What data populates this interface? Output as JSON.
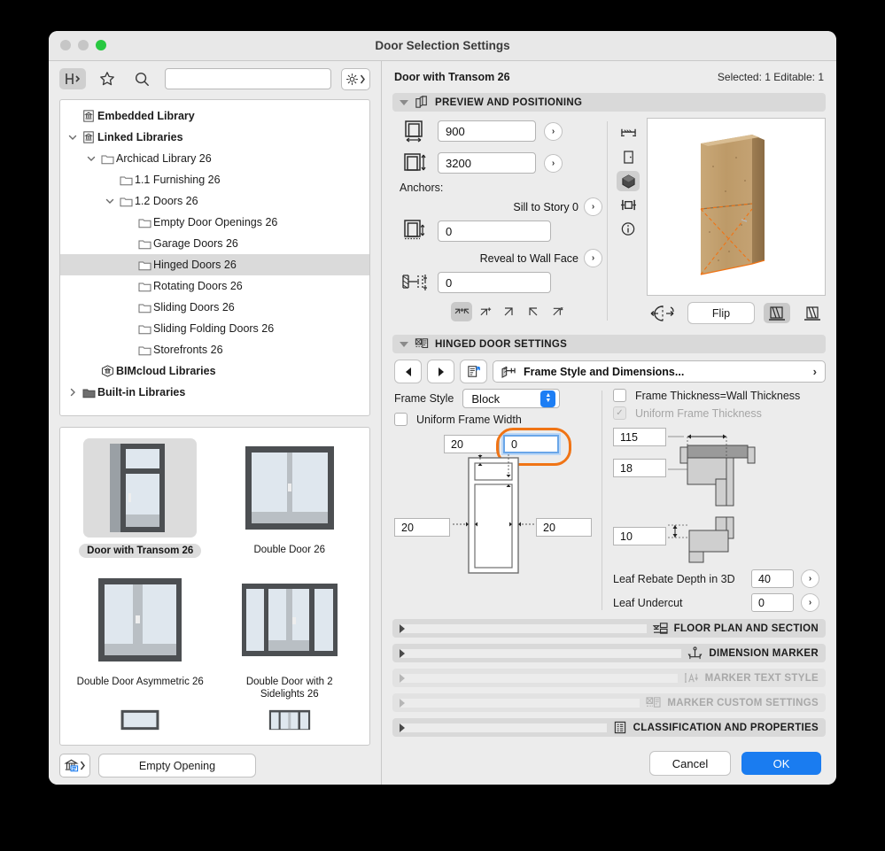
{
  "window": {
    "title": "Door Selection Settings"
  },
  "left_panel": {
    "toolbar": {
      "object_tool_icon": "chair-icon",
      "favorites_icon": "star-icon",
      "search_icon": "magnifier-icon",
      "search_value": "",
      "search_placeholder": "",
      "settings_icon": "gear-icon"
    },
    "tree": [
      {
        "label": "Embedded Library",
        "depth": 0,
        "bold": true,
        "icon": "embedded-library-icon",
        "twisty": "none",
        "selected": false
      },
      {
        "label": "Linked Libraries",
        "depth": 0,
        "bold": true,
        "icon": "linked-library-icon",
        "twisty": "open",
        "selected": false
      },
      {
        "label": "Archicad Library 26",
        "depth": 1,
        "bold": false,
        "icon": "folder-icon",
        "twisty": "open",
        "selected": false
      },
      {
        "label": "1.1 Furnishing 26",
        "depth": 2,
        "bold": false,
        "icon": "folder-icon",
        "twisty": "none",
        "selected": false
      },
      {
        "label": "1.2 Doors 26",
        "depth": 2,
        "bold": false,
        "icon": "folder-icon",
        "twisty": "open",
        "selected": false
      },
      {
        "label": "Empty Door Openings 26",
        "depth": 3,
        "bold": false,
        "icon": "folder-icon",
        "twisty": "none",
        "selected": false
      },
      {
        "label": "Garage Doors 26",
        "depth": 3,
        "bold": false,
        "icon": "folder-icon",
        "twisty": "none",
        "selected": false
      },
      {
        "label": "Hinged Doors 26",
        "depth": 3,
        "bold": false,
        "icon": "folder-icon",
        "twisty": "none",
        "selected": true
      },
      {
        "label": "Rotating Doors 26",
        "depth": 3,
        "bold": false,
        "icon": "folder-icon",
        "twisty": "none",
        "selected": false
      },
      {
        "label": "Sliding Doors 26",
        "depth": 3,
        "bold": false,
        "icon": "folder-icon",
        "twisty": "none",
        "selected": false
      },
      {
        "label": "Sliding Folding Doors 26",
        "depth": 3,
        "bold": false,
        "icon": "folder-icon",
        "twisty": "none",
        "selected": false
      },
      {
        "label": "Storefronts 26",
        "depth": 3,
        "bold": false,
        "icon": "folder-icon",
        "twisty": "none",
        "selected": false
      },
      {
        "label": "BIMcloud Libraries",
        "depth": 1,
        "bold": true,
        "icon": "bimcloud-icon",
        "twisty": "none",
        "selected": false
      },
      {
        "label": "Built-in Libraries",
        "depth": 0,
        "bold": true,
        "icon": "folder-dark-icon",
        "twisty": "closed",
        "selected": false
      }
    ],
    "gallery": [
      {
        "label": "Door with Transom 26",
        "selected": true,
        "kind": "transom"
      },
      {
        "label": "Double Door 26",
        "selected": false,
        "kind": "double"
      },
      {
        "label": "Double Door Asymmetric 26",
        "selected": false,
        "kind": "asym"
      },
      {
        "label": "Double Door with 2 Sidelights 26",
        "selected": false,
        "kind": "sidelights"
      }
    ],
    "footer": {
      "library_icon": "library-manager-icon",
      "empty_opening_label": "Empty Opening"
    }
  },
  "right_panel": {
    "object_name": "Door with Transom 26",
    "selection_info": "Selected: 1 Editable: 1",
    "sections": {
      "preview_positioning": {
        "title": "PREVIEW AND POSITIONING",
        "icon": "preview-cube-icon",
        "expanded": true,
        "width_value": "900",
        "width_icon": "door-width-icon",
        "height_value": "3200",
        "height_icon": "door-height-icon",
        "anchors_label": "Anchors:",
        "sill_label": "Sill to Story 0",
        "sill_value": "0",
        "sill_icon": "sill-anchor-icon",
        "reveal_label": "Reveal to Wall Face",
        "reveal_value": "0",
        "reveal_icon": "reveal-anchor-icon",
        "anchor_buttons": [
          "anchor-center-icon",
          "anchor-topleft-icon",
          "anchor-left-icon",
          "anchor-right-icon",
          "anchor-bottom-icon"
        ],
        "anchor_selected_index": 0,
        "view_tools": [
          "elevation-view-icon",
          "floorplan-view-icon",
          "3d-view-icon",
          "section-view-icon",
          "info-icon"
        ],
        "view_selected_index": 2,
        "flip_label": "Flip",
        "flip_icon": "mirror-icon",
        "side_buttons": [
          "wall-side-left-icon",
          "wall-side-right-icon"
        ],
        "side_selected_index": 0
      },
      "hinged_door": {
        "title": "HINGED DOOR SETTINGS",
        "icon": "hinged-door-settings-icon",
        "expanded": true,
        "prev_icon": "arrow-left-icon",
        "next_icon": "arrow-right-icon",
        "list_icon": "page-list-icon",
        "page_icon": "frame-style-icon",
        "page_label": "Frame Style and Dimensions...",
        "page_chevron": "chevron-right-icon",
        "frame_style_label": "Frame Style",
        "frame_style_value": "Block",
        "uniform_frame_width_label": "Uniform Frame Width",
        "uniform_frame_width_checked": false,
        "frame_thickness_wall_label": "Frame Thickness=Wall Thickness",
        "frame_thickness_wall_checked": false,
        "uniform_frame_thickness_label": "Uniform Frame Thickness",
        "uniform_frame_thickness_checked": true,
        "uniform_frame_thickness_disabled": true,
        "dim_top_left": "20",
        "dim_top_right": "0",
        "dim_top_right_focused": true,
        "dim_left": "20",
        "dim_right": "20",
        "dim_115": "115",
        "dim_18": "18",
        "dim_10": "10",
        "leaf_rebate_label": "Leaf Rebate Depth in 3D",
        "leaf_rebate_value": "40",
        "leaf_undercut_label": "Leaf Undercut",
        "leaf_undercut_value": "0"
      },
      "collapsed": [
        {
          "title": "FLOOR PLAN AND SECTION",
          "icon": "floorplan-section-icon",
          "disabled": false
        },
        {
          "title": "DIMENSION MARKER",
          "icon": "dimension-marker-icon",
          "disabled": false
        },
        {
          "title": "MARKER TEXT STYLE",
          "icon": "marker-text-style-icon",
          "disabled": true
        },
        {
          "title": "MARKER CUSTOM SETTINGS",
          "icon": "marker-custom-settings-icon",
          "disabled": true
        },
        {
          "title": "CLASSIFICATION AND PROPERTIES",
          "icon": "classification-icon",
          "disabled": false
        }
      ]
    },
    "footer": {
      "cancel_label": "Cancel",
      "ok_label": "OK"
    }
  },
  "colors": {
    "accent_blue": "#1a7cf0",
    "highlight_orange": "#f07415",
    "panel_bg": "#ececec",
    "section_bar": "#d9d9d9",
    "focus_blue": "#6aa6e8"
  }
}
